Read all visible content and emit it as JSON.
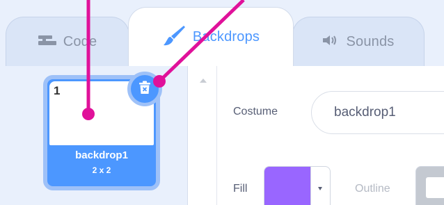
{
  "tabs": [
    {
      "label": "Code",
      "icon": "code-blocks-icon",
      "active": false
    },
    {
      "label": "Backdrops",
      "icon": "paintbrush-icon",
      "active": true
    },
    {
      "label": "Sounds",
      "icon": "speaker-icon",
      "active": false
    }
  ],
  "backdrop_list": {
    "items": [
      {
        "number": "1",
        "name": "backdrop1",
        "size": "2 x 2",
        "selected": true
      }
    ]
  },
  "editor": {
    "costume_label": "Costume",
    "costume_name": "backdrop1",
    "fill_label": "Fill",
    "outline_label": "Outline"
  },
  "colors": {
    "accent": "#4c97ff",
    "fill": "#9966ff",
    "annotation": "#e0119a",
    "tab_background": "#e9f0fc"
  }
}
